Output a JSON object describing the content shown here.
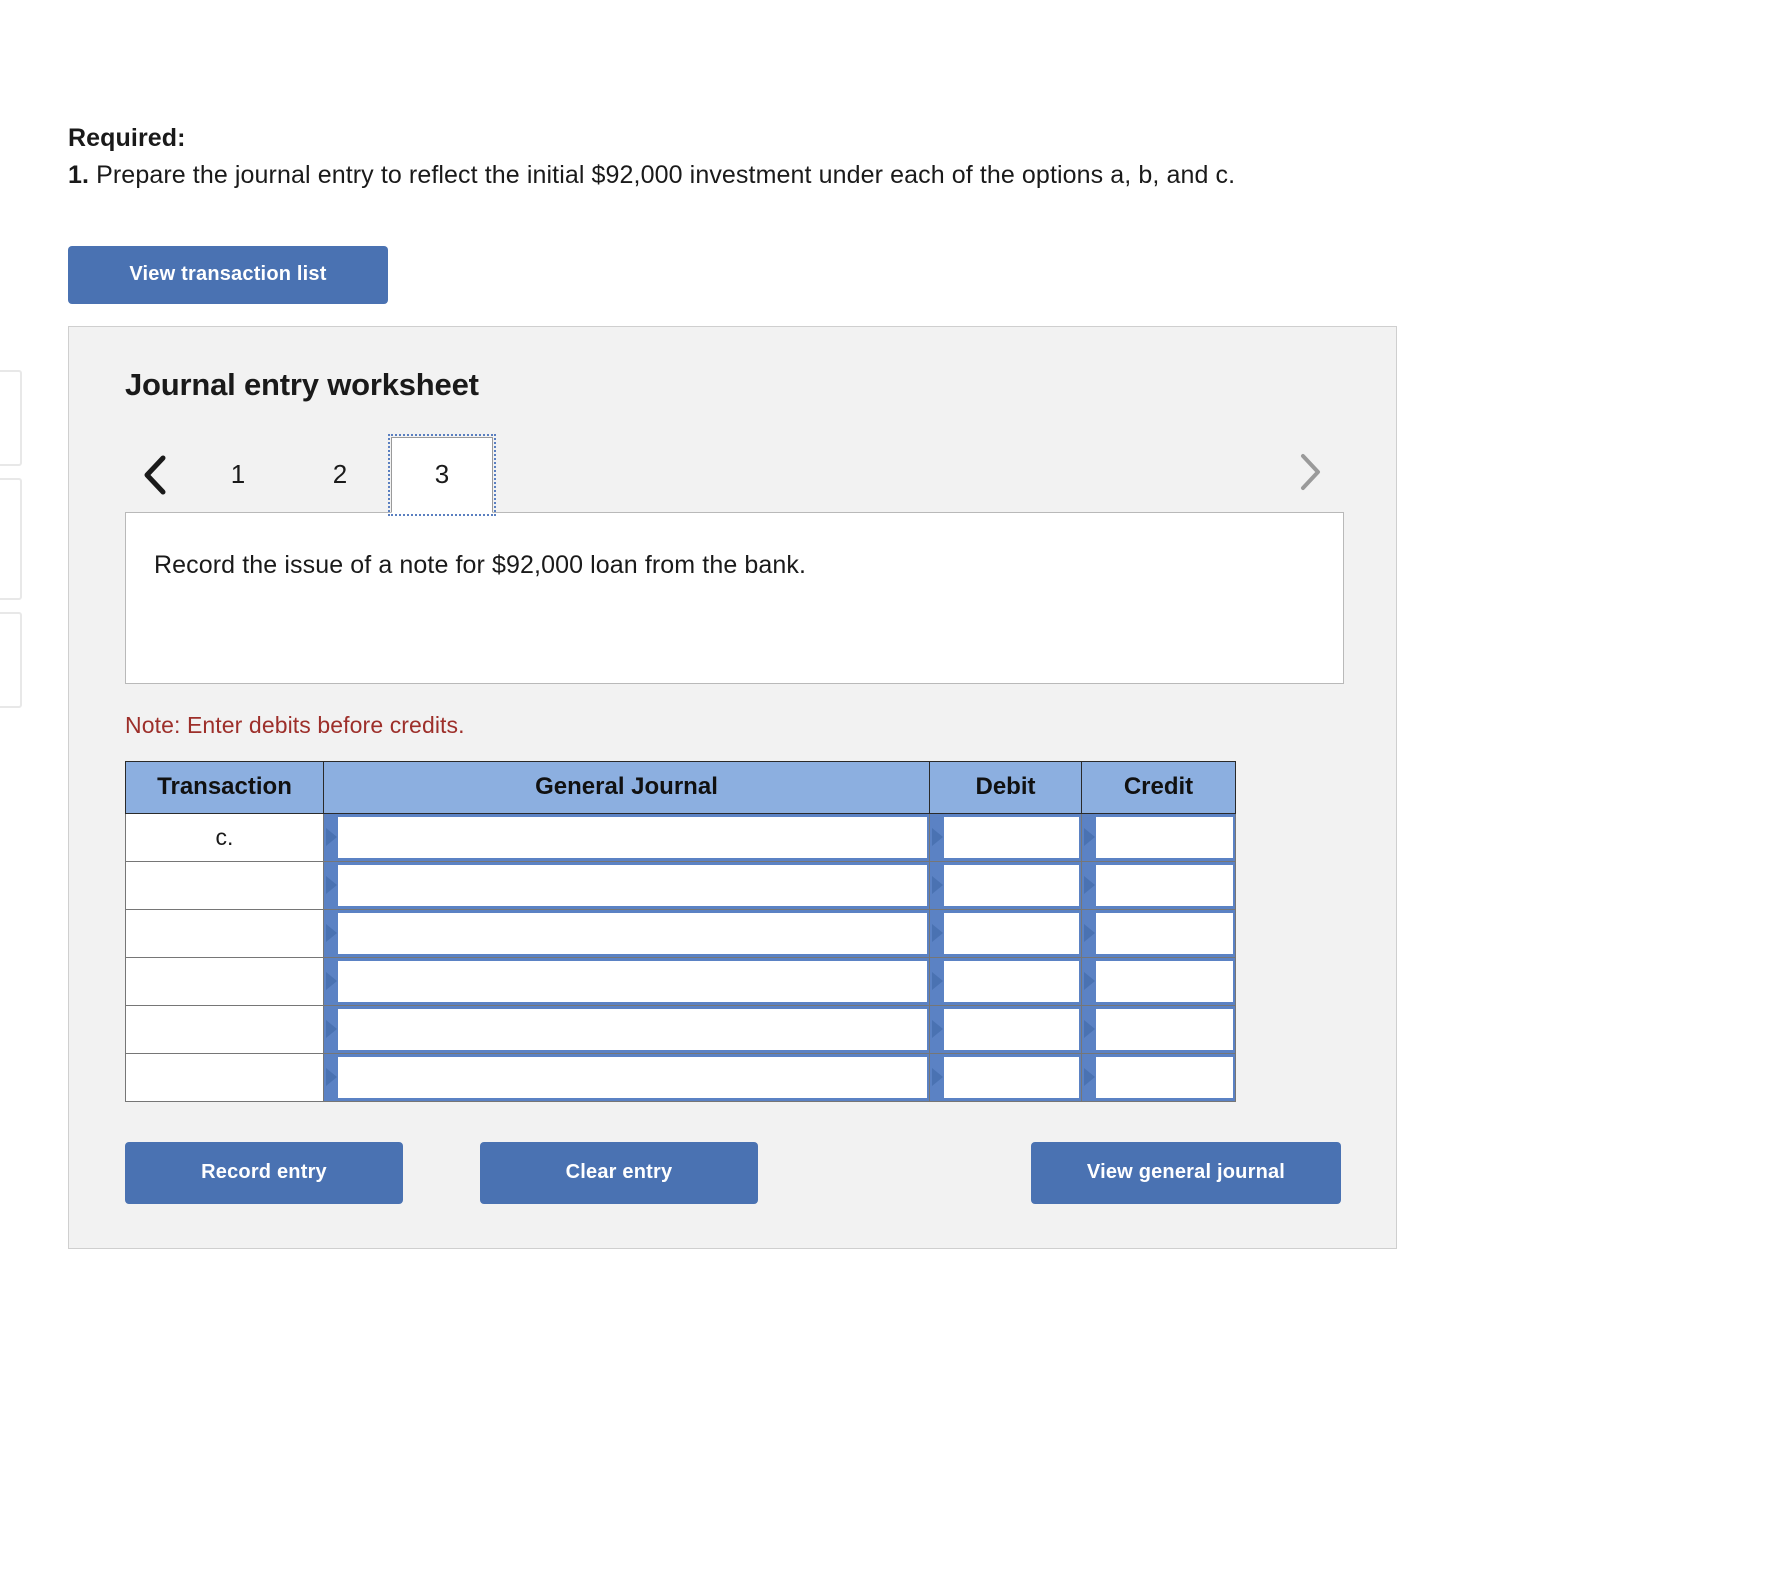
{
  "required": {
    "heading": "Required:",
    "item_number": "1.",
    "item_text": "Prepare the journal entry to reflect the initial $92,000 investment under each of the options a, b, and c."
  },
  "toolbar": {
    "view_transaction_list": "View transaction list"
  },
  "worksheet": {
    "title": "Journal entry worksheet",
    "pager": {
      "prev_icon": "chevron-left-icon",
      "next_icon": "chevron-right-icon",
      "tabs": [
        {
          "label": "1",
          "active": false
        },
        {
          "label": "2",
          "active": false
        },
        {
          "label": "3",
          "active": true
        }
      ]
    },
    "description": "Record the issue of a note for $92,000 loan from the bank.",
    "note": "Note: Enter debits before credits."
  },
  "table": {
    "headers": [
      "Transaction",
      "General Journal",
      "Debit",
      "Credit"
    ],
    "rows": [
      {
        "transaction": "c.",
        "general_journal": "",
        "debit": "",
        "credit": ""
      },
      {
        "transaction": "",
        "general_journal": "",
        "debit": "",
        "credit": ""
      },
      {
        "transaction": "",
        "general_journal": "",
        "debit": "",
        "credit": ""
      },
      {
        "transaction": "",
        "general_journal": "",
        "debit": "",
        "credit": ""
      },
      {
        "transaction": "",
        "general_journal": "",
        "debit": "",
        "credit": ""
      },
      {
        "transaction": "",
        "general_journal": "",
        "debit": "",
        "credit": ""
      }
    ]
  },
  "footer": {
    "record_entry": "Record entry",
    "clear_entry": "Clear entry",
    "view_general_journal": "View general journal"
  },
  "colors": {
    "button_blue": "#4a72b2",
    "header_blue": "#8cafe0",
    "field_blue": "#5b82c4",
    "note_red": "#9d2f2a",
    "panel_gray": "#f2f2f2"
  }
}
